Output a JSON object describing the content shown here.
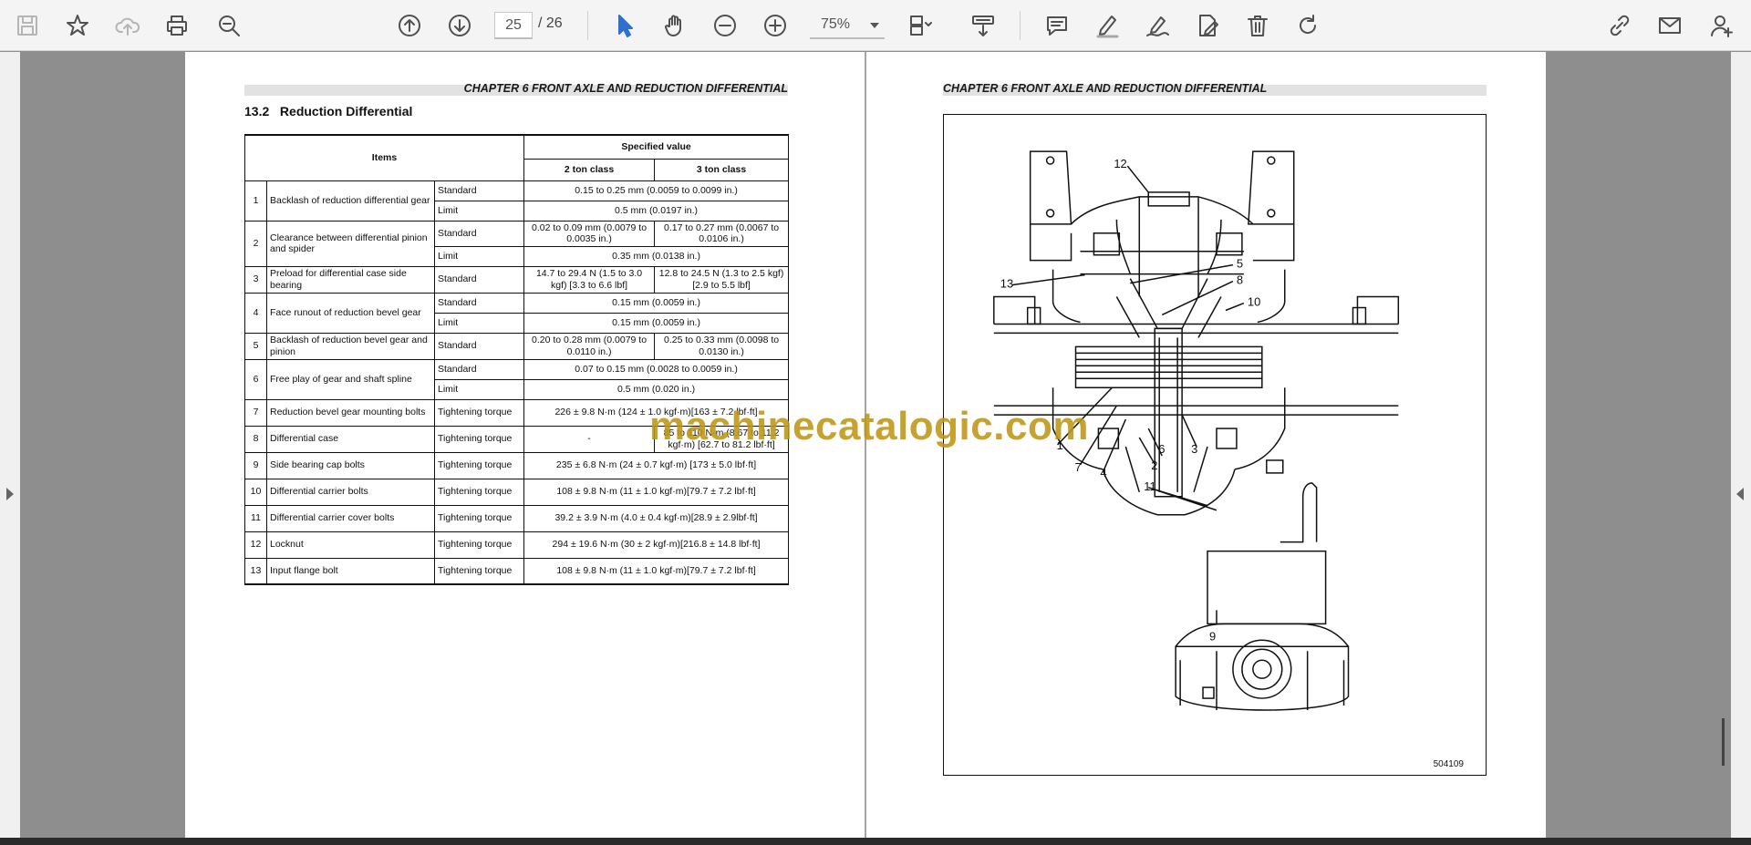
{
  "toolbar": {
    "page_current": "25",
    "page_total": "/ 26",
    "zoom": "75%"
  },
  "left_page": {
    "chapter_header": "CHAPTER 6 FRONT AXLE AND REDUCTION DIFFERENTIAL",
    "section_title": "13.2   Reduction Differential",
    "table": {
      "col_items": "Items",
      "col_specified": "Specified value",
      "col_2ton": "2 ton class",
      "col_3ton": "3 ton class",
      "rows": [
        {
          "no": "1",
          "item": "Backlash of reduction differential gear",
          "subs": [
            {
              "type": "Standard",
              "v2": "0.15 to 0.25 mm (0.0059 to 0.0099 in.)",
              "v3": null
            },
            {
              "type": "Limit",
              "v2": "0.5 mm (0.0197 in.)",
              "v3": null
            }
          ]
        },
        {
          "no": "2",
          "item": "Clearance between differential pinion and spider",
          "subs": [
            {
              "type": "Standard",
              "v2": "0.02 to 0.09 mm (0.0079 to 0.0035 in.)",
              "v3": "0.17 to 0.27 mm (0.0067 to 0.0106 in.)"
            },
            {
              "type": "Limit",
              "v2": "0.35 mm (0.0138 in.)",
              "v3": null
            }
          ]
        },
        {
          "no": "3",
          "item": "Preload for differential case side bearing",
          "subs": [
            {
              "type": "Standard",
              "v2": "14.7 to 29.4 N (1.5 to 3.0 kgf) [3.3 to 6.6 lbf]",
              "v3": "12.8 to 24.5 N (1.3 to 2.5 kgf) [2.9 to 5.5 lbf]"
            }
          ]
        },
        {
          "no": "4",
          "item": "Face runout of reduction bevel gear",
          "subs": [
            {
              "type": "Standard",
              "v2": "0.15 mm (0.0059 in.)",
              "v3": null
            },
            {
              "type": "Limit",
              "v2": "0.15 mm (0.0059 in.)",
              "v3": null
            }
          ]
        },
        {
          "no": "5",
          "item": "Backlash of reduction bevel gear and pinion",
          "subs": [
            {
              "type": "Standard",
              "v2": "0.20 to 0.28 mm (0.0079 to 0.0110 in.)",
              "v3": "0.25 to 0.33 mm (0.0098 to 0.0130 in.)"
            }
          ]
        },
        {
          "no": "6",
          "item": "Free play of gear and shaft spline",
          "subs": [
            {
              "type": "Standard",
              "v2": "0.07 to 0.15 mm (0.0028 to 0.0059 in.)",
              "v3": null
            },
            {
              "type": "Limit",
              "v2": "0.5 mm (0.020 in.)",
              "v3": null
            }
          ]
        },
        {
          "no": "7",
          "item": "Reduction bevel gear mounting bolts",
          "subs": [
            {
              "type": "Tightening torque",
              "v2": "226 ± 9.8 N·m (124 ± 1.0 kgf·m)[163 ± 7.2 lbf·ft]",
              "v3": null
            }
          ]
        },
        {
          "no": "8",
          "item": "Differential case",
          "subs": [
            {
              "type": "Tightening torque",
              "v2": "-",
              "v3": "85 to 110 N·m (8.67 to 11.2 kgf·m) [62.7 to 81.2 lbf·ft]"
            }
          ]
        },
        {
          "no": "9",
          "item": "Side bearing cap bolts",
          "subs": [
            {
              "type": "Tightening torque",
              "v2": "235 ± 6.8 N·m (24 ± 0.7 kgf·m) [173 ± 5.0 lbf·ft]",
              "v3": null
            }
          ]
        },
        {
          "no": "10",
          "item": "Differential carrier bolts",
          "subs": [
            {
              "type": "Tightening torque",
              "v2": "108 ± 9.8 N·m (11 ± 1.0 kgf·m)[79.7 ± 7.2 lbf·ft]",
              "v3": null
            }
          ]
        },
        {
          "no": "11",
          "item": "Differential carrier cover bolts",
          "subs": [
            {
              "type": "Tightening torque",
              "v2": "39.2 ± 3.9 N·m (4.0 ± 0.4 kgf·m)[28.9 ± 2.9lbf·ft]",
              "v3": null
            }
          ]
        },
        {
          "no": "12",
          "item": "Locknut",
          "subs": [
            {
              "type": "Tightening torque",
              "v2": "294 ± 19.6 N·m (30 ± 2 kgf·m)[216.8 ± 14.8 lbf·ft]",
              "v3": null
            }
          ]
        },
        {
          "no": "13",
          "item": "Input flange bolt",
          "subs": [
            {
              "type": "Tightening torque",
              "v2": "108 ± 9.8 N·m (11 ± 1.0 kgf·m)[79.7 ± 7.2 lbf·ft]",
              "v3": null
            }
          ]
        }
      ]
    }
  },
  "right_page": {
    "chapter_header": "CHAPTER 6 FRONT AXLE AND REDUCTION DIFFERENTIAL",
    "figure_code": "504109",
    "callouts": [
      "12",
      "5",
      "8",
      "10",
      "13",
      "1",
      "7",
      "4",
      "2",
      "6",
      "3",
      "11",
      "9"
    ]
  },
  "watermark": "machinecatalogic.com",
  "icons": [
    "save-icon",
    "bookmark-star-icon",
    "upload-cloud-icon",
    "print-icon",
    "zoom-search-icon",
    "page-up-icon",
    "page-down-icon",
    "select-cursor-icon",
    "hand-pan-icon",
    "zoom-out-icon",
    "zoom-in-icon",
    "fit-page-icon",
    "scroll-mode-icon",
    "comment-icon",
    "highlight-pen-icon",
    "draw-pen-icon",
    "stamp-icon",
    "delete-icon",
    "rotate-icon",
    "link-share-icon",
    "email-icon",
    "add-user-icon"
  ]
}
